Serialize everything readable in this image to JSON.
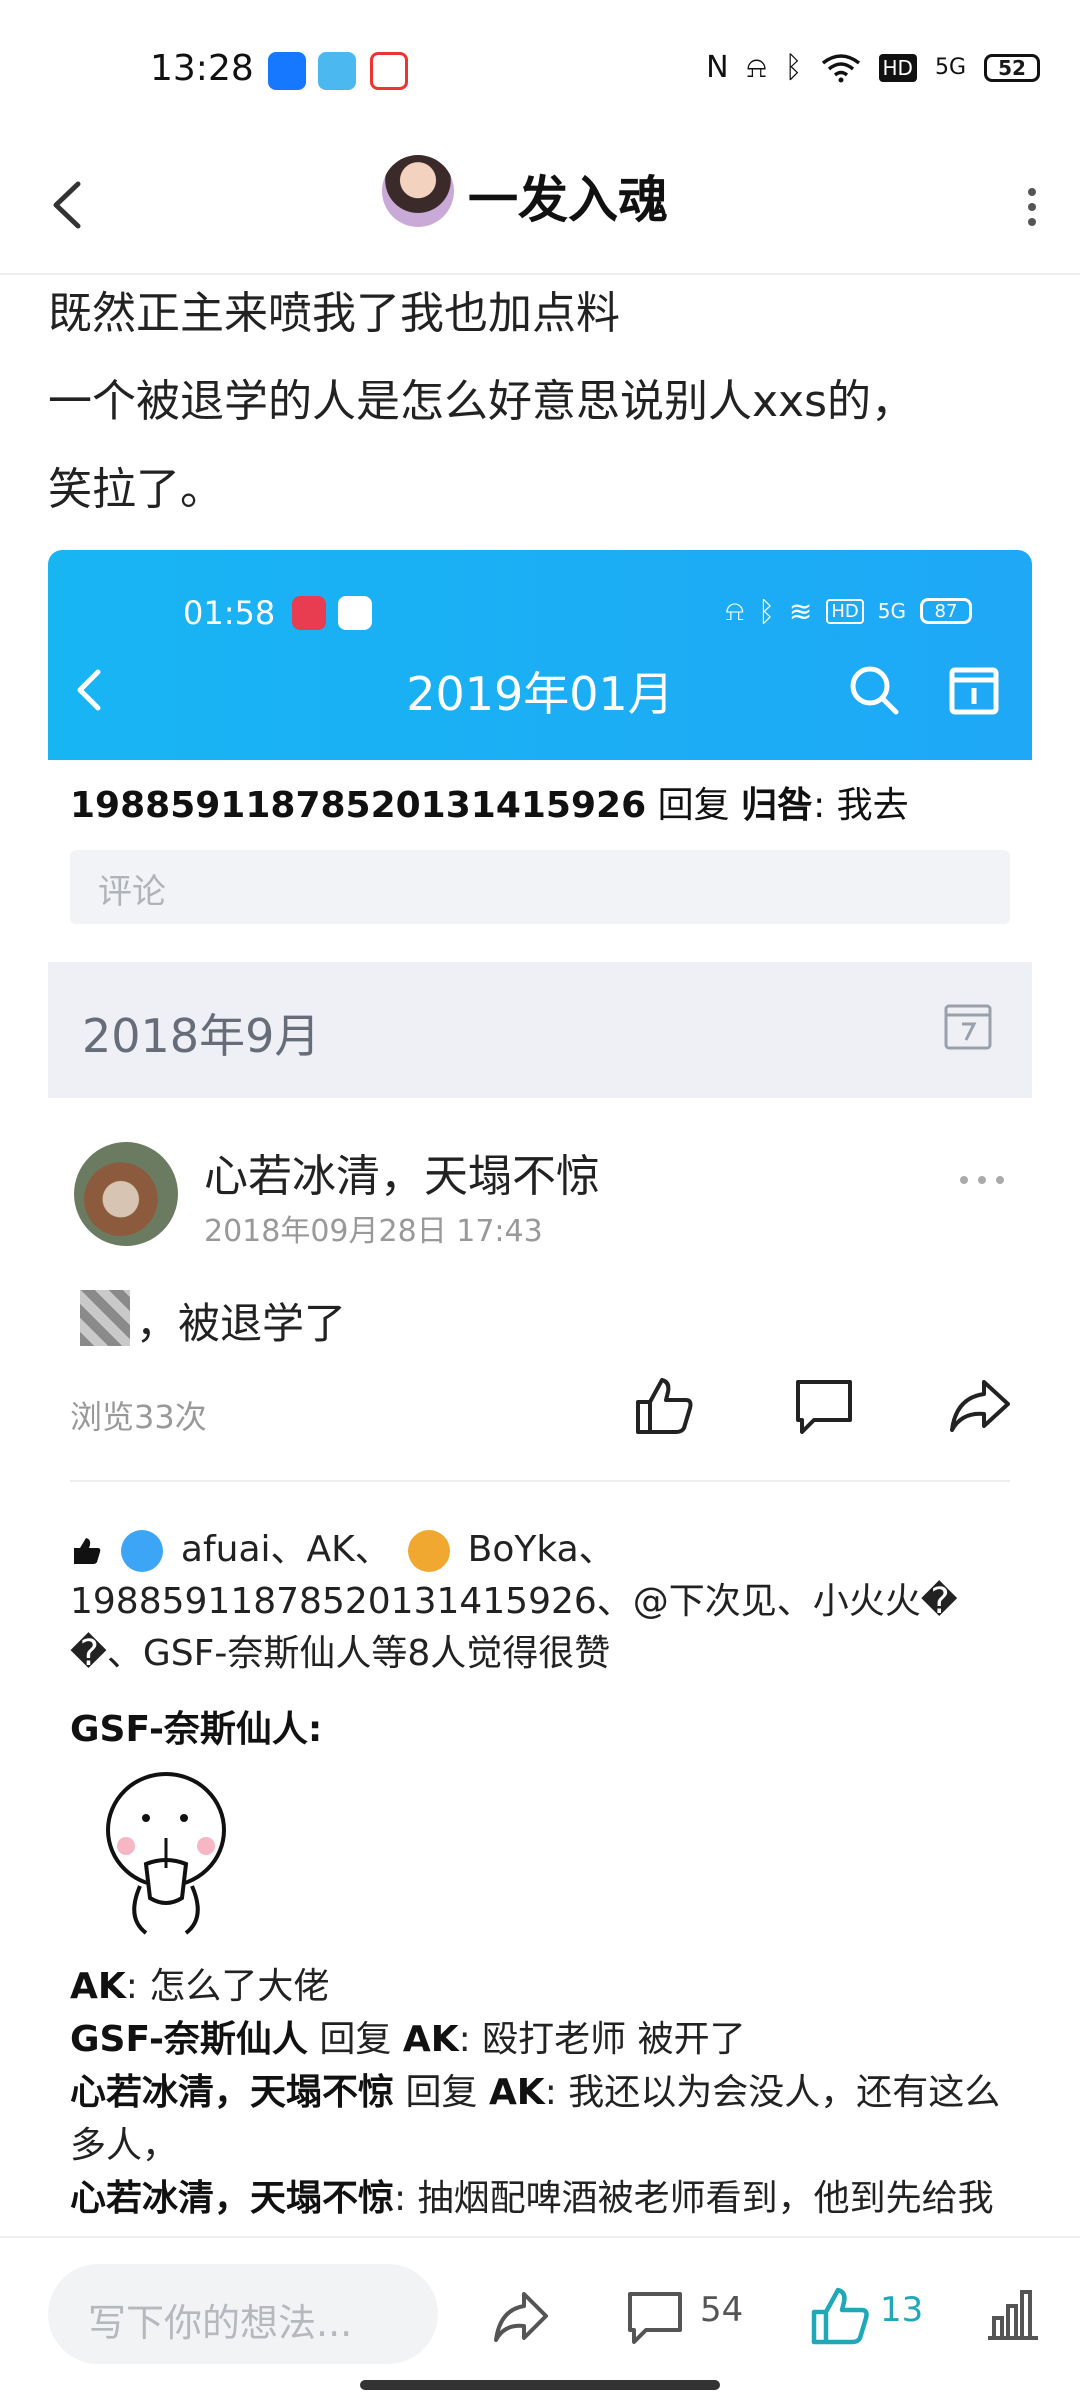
{
  "status_bar": {
    "time": "13:28",
    "icons": [
      "alipay-icon",
      "send-icon",
      "map-icon",
      "nfc-icon",
      "mute-icon",
      "bluetooth-icon",
      "wifi-icon",
      "hd-icon",
      "5g-icon",
      "battery-icon"
    ],
    "battery": "52"
  },
  "header": {
    "title": "一发入魂"
  },
  "post": {
    "line1": "既然正主来喷我了我也加点料",
    "line2": "一个被退学的人是怎么好意思说别人xxs的，",
    "line3": "笑拉了。"
  },
  "embedded": {
    "status_time": "01:58",
    "battery": "87",
    "title": "2019年01月",
    "reply_user": "19885911878520131415926",
    "reply_word": "回复",
    "reply_target": "归咎",
    "reply_text": ": 我去",
    "comment_placeholder": "评论",
    "month_label": "2018年9月",
    "author_name": "心若冰清，天塌不惊",
    "author_date": "2018年09月28日 17:43",
    "moment_text": "，被退学了",
    "views": "浏览33次",
    "likes_text": "afuai、AK、",
    "likes_user_boyka": "BoYka、",
    "likes_line2": "19885911878520131415926、@下次见、小火火�",
    "likes_line3": "�、GSF-奈斯仙人等8人觉得很赞",
    "gsf_name": "GSF-奈斯仙人:",
    "comments": [
      {
        "user": "AK",
        "reply_to": "",
        "text": ": 怎么了大佬"
      },
      {
        "user": "GSF-奈斯仙人",
        "reply_to": "AK",
        "text": ": 殴打老师 被开了"
      },
      {
        "user": "心若冰清，天塌不惊",
        "reply_to": "AK",
        "text": ": 我还以为会没人，还有这么多人，"
      },
      {
        "user": "心若冰清，天塌不惊",
        "reply_to": "",
        "text": ": 抽烟配啤酒被老师看到，他到先给我一脚，气不过还手了"
      }
    ]
  },
  "bottom_bar": {
    "input_placeholder": "写下你的想法...",
    "comment_count": "54",
    "like_count": "13"
  },
  "colors": {
    "accent": "#1ea8f6",
    "like_active": "#1ea8b8"
  }
}
